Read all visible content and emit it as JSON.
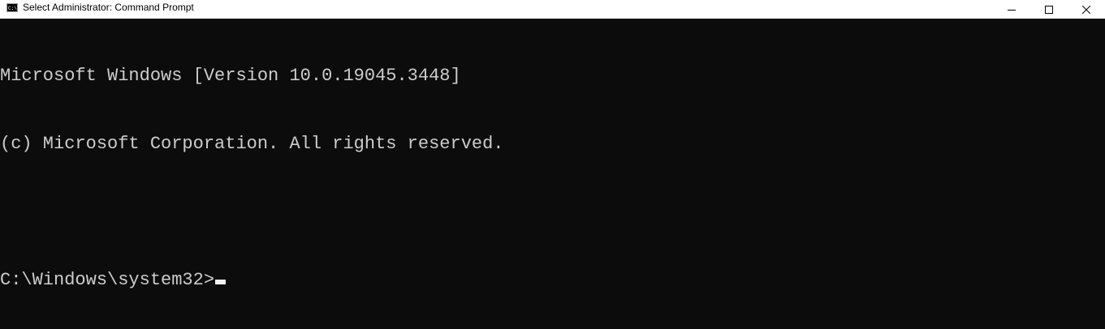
{
  "window": {
    "title": "Select Administrator: Command Prompt",
    "icon": "cmd-icon",
    "background_color": "#0c0c0c",
    "text_color": "#cccccc"
  },
  "caption": {
    "minimize_icon": "minimize-icon",
    "maximize_icon": "maximize-icon",
    "close_icon": "close-icon"
  },
  "console": {
    "lines": [
      "Microsoft Windows [Version 10.0.19045.3448]",
      "(c) Microsoft Corporation. All rights reserved.",
      ""
    ],
    "prompt": "C:\\Windows\\system32>",
    "input": ""
  }
}
